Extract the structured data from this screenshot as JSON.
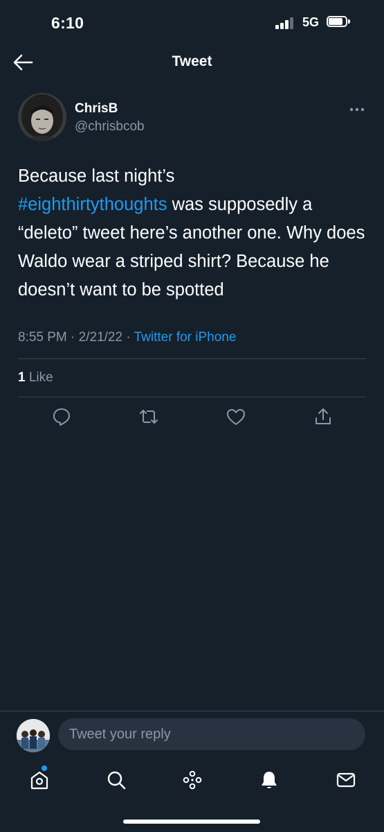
{
  "status_bar": {
    "time": "6:10",
    "network": "5G"
  },
  "header": {
    "title": "Tweet"
  },
  "tweet": {
    "author_name": "ChrisB",
    "author_handle": "@chrisbcob",
    "text_line1": "Because last night’s",
    "hashtag": "#eighthirtythoughts",
    "text_rest": " was supposedly a “deleto” tweet here’s another one. Why does Waldo wear a striped shirt? Because he doesn’t want to be spotted",
    "time": "8:55 PM",
    "date": "2/21/22",
    "separator": " · ",
    "source": "Twitter for iPhone",
    "like_count": "1",
    "like_label": "Like"
  },
  "actions": [
    "reply-icon",
    "retweet-icon",
    "like-icon",
    "share-icon"
  ],
  "reply_bar": {
    "placeholder": "Tweet your reply"
  },
  "tabbar": [
    "home-icon",
    "search-icon",
    "spaces-icon",
    "notifications-icon",
    "messages-icon"
  ],
  "colors": {
    "background": "#15202b",
    "accent": "#1d9bf0",
    "secondary_text": "#8b98a5",
    "divider": "#38444d"
  }
}
